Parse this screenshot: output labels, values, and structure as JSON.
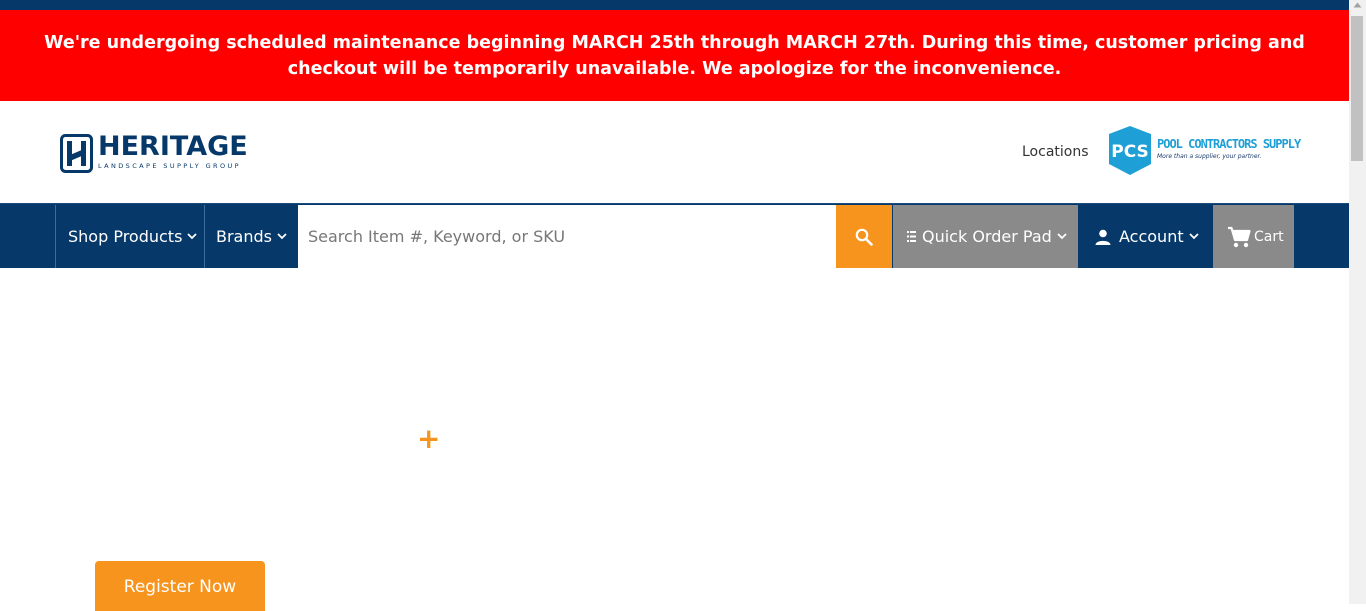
{
  "alert": {
    "message": "We're undergoing scheduled maintenance beginning MARCH 25th through MARCH 27th. During this time, customer pricing and checkout will be temporarily unavailable. We apologize for the inconvenience."
  },
  "header": {
    "logo_name": "HERITAGE",
    "logo_tagline": "LANDSCAPE SUPPLY GROUP",
    "locations_label": "Locations",
    "partner_badge": "PCS",
    "partner_name": "POOL CONTRACTORS SUPPLY",
    "partner_tagline": "More than a supplier, your partner."
  },
  "nav": {
    "shop_products": "Shop Products",
    "brands": "Brands",
    "search_placeholder": "Search Item #, Keyword, or SKU",
    "quick_order_pad": "Quick Order Pad",
    "account": "Account",
    "cart": "Cart"
  },
  "main": {
    "plus_symbol": "+",
    "register_button": "Register Now"
  },
  "colors": {
    "navy": "#06386a",
    "alert_red": "#ff0000",
    "accent_orange": "#f7941d",
    "nav_gray": "#8a8a8a",
    "pcs_blue": "#1ea0d6"
  },
  "icons": {
    "chevron": "chevron-down-icon",
    "search": "search-icon",
    "quick_order": "list-icon",
    "account": "user-icon",
    "cart": "cart-icon"
  }
}
